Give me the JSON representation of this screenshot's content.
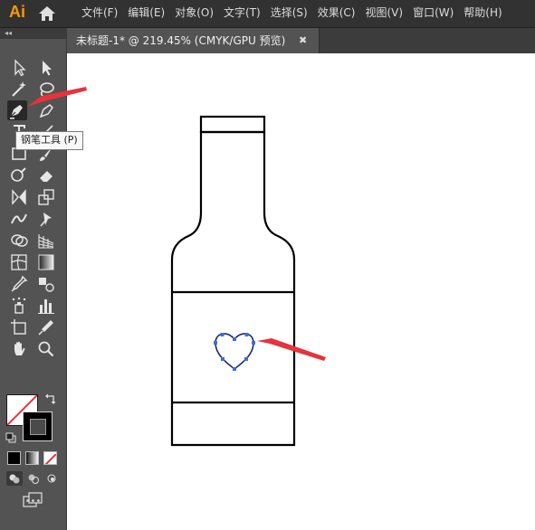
{
  "app": {
    "logo": "Ai"
  },
  "menu": {
    "items": [
      "文件(F)",
      "编辑(E)",
      "对象(O)",
      "文字(T)",
      "选择(S)",
      "效果(C)",
      "视图(V)",
      "窗口(W)",
      "帮助(H)"
    ]
  },
  "panel": {
    "collapse_label": "◂◂",
    "more_label": "•••"
  },
  "document_tab": {
    "title": "未标题-1* @ 219.45% (CMYK/GPU 预览)",
    "close_label": "✖"
  },
  "tooltip": {
    "text": "钢笔工具 (P)"
  },
  "colors": {
    "accent_arrow": "#e8323c",
    "path_selection": "#3d6fd8",
    "fill": "#ffffff",
    "stroke": "#000000"
  },
  "tools": [
    "selection-tool",
    "direct-selection-tool",
    "magic-wand-tool",
    "lasso-tool",
    "pen-tool",
    "curvature-tool",
    "type-tool",
    "line-segment-tool",
    "rectangle-tool",
    "paintbrush-tool",
    "shaper-tool",
    "eraser-tool",
    "rotate-tool",
    "scale-tool",
    "width-tool",
    "puppet-warp-tool",
    "shape-builder-tool",
    "perspective-grid-tool",
    "mesh-tool",
    "gradient-tool",
    "eyedropper-tool",
    "blend-tool",
    "symbol-sprayer-tool",
    "column-graph-tool",
    "artboard-tool",
    "slice-tool",
    "hand-tool",
    "zoom-tool"
  ]
}
